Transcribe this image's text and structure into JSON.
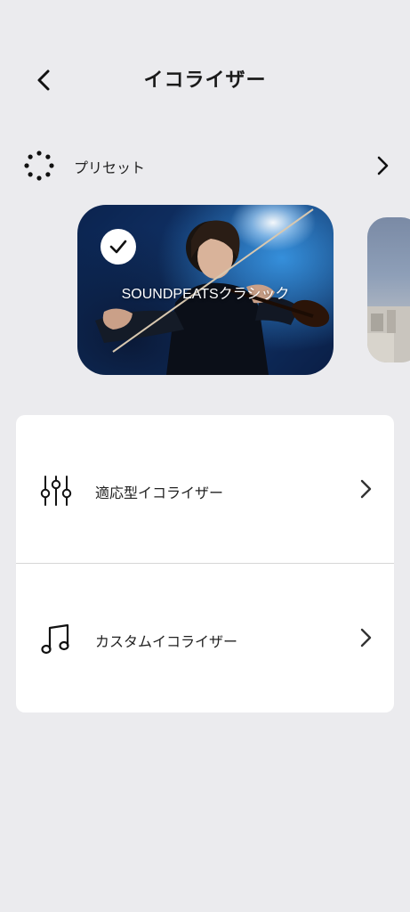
{
  "header": {
    "title": "イコライザー",
    "back_icon": "chevron-left-icon"
  },
  "preset": {
    "label": "プリセット",
    "icon": "dotted-circle-icon",
    "chevron_icon": "chevron-right-icon",
    "cards": [
      {
        "title": "SOUNDPEATSクラシック",
        "selected": true
      },
      {
        "title": "",
        "selected": false
      }
    ]
  },
  "eq_options": [
    {
      "label": "適応型イコライザー",
      "icon": "equalizer-sliders-icon"
    },
    {
      "label": "カスタムイコライザー",
      "icon": "music-note-icon"
    }
  ],
  "colors": {
    "background": "#ebebee",
    "panel": "#ffffff",
    "text": "#1a1a1a"
  }
}
